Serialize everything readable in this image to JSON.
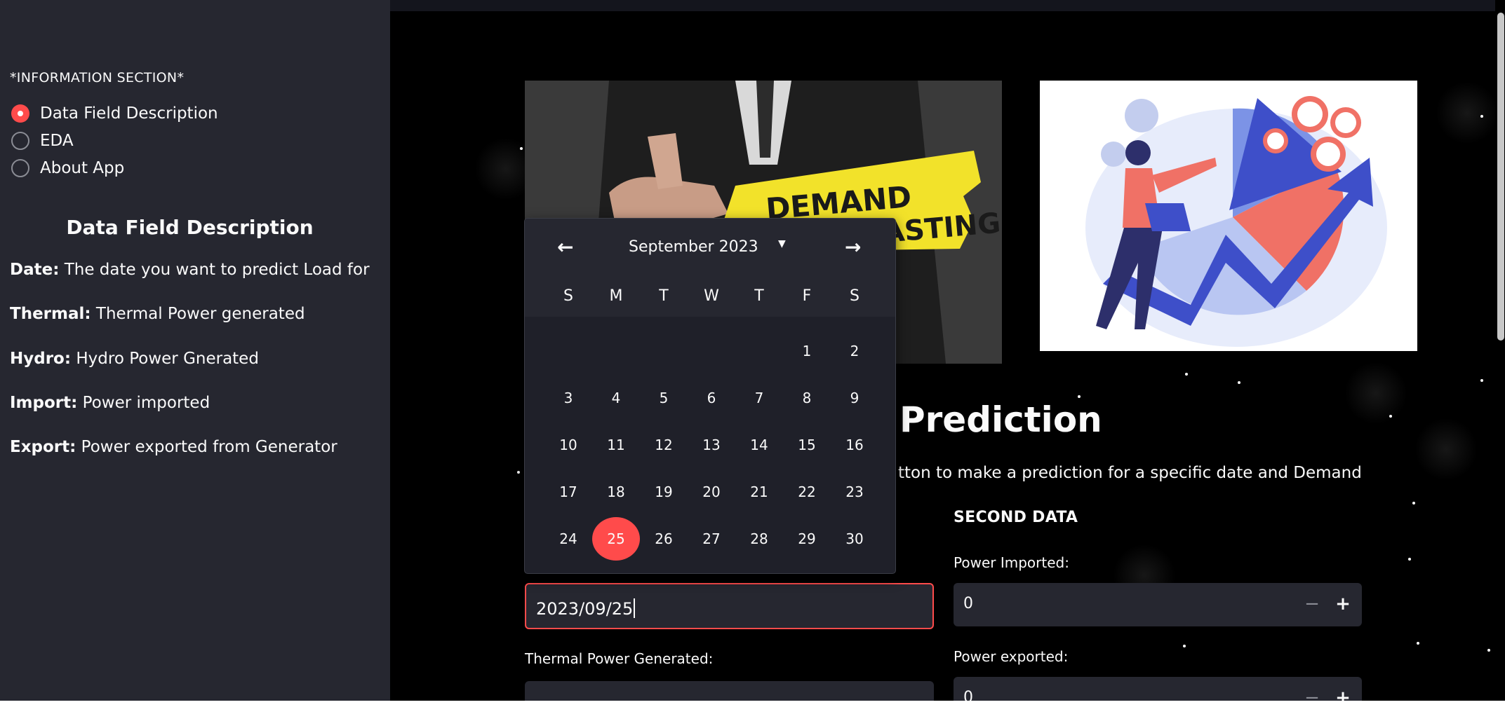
{
  "sidebar": {
    "section_title": "*INFORMATION SECTION*",
    "options": [
      {
        "label": "Data Field Description",
        "selected": true
      },
      {
        "label": "EDA",
        "selected": false
      },
      {
        "label": "About App",
        "selected": false
      }
    ],
    "heading": "Data Field Description",
    "fields": [
      {
        "name": "Date:",
        "desc": "The date you want to predict Load for"
      },
      {
        "name": "Thermal:",
        "desc": "Thermal Power generated"
      },
      {
        "name": "Hydro:",
        "desc": "Hydro Power Gnerated"
      },
      {
        "name": "Import:",
        "desc": "Power imported"
      },
      {
        "name": "Export:",
        "desc": "Power exported from Generator"
      }
    ]
  },
  "images": {
    "left_text_1": "DEMAND",
    "left_text_2": "ECASTING"
  },
  "main": {
    "title": "Prediction",
    "subtitle": "tton to make a prediction for a specific date and Demand",
    "second_data_label": "SECOND DATA",
    "power_imported_label": "Power Imported:",
    "power_imported_value": "0",
    "power_exported_label": "Power exported:",
    "power_exported_value": "0",
    "thermal_label": "Thermal Power Generated:",
    "date_value": "2023/09/25",
    "minus": "−",
    "plus": "+"
  },
  "calendar": {
    "month_label": "September 2023",
    "prev": "←",
    "next": "→",
    "chevron": "▼",
    "weekdays": [
      "S",
      "M",
      "T",
      "W",
      "T",
      "F",
      "S"
    ],
    "days": [
      "1",
      "2",
      "3",
      "4",
      "5",
      "6",
      "7",
      "8",
      "9",
      "10",
      "11",
      "12",
      "13",
      "14",
      "15",
      "16",
      "17",
      "18",
      "19",
      "20",
      "21",
      "22",
      "23",
      "24",
      "25",
      "26",
      "27",
      "28",
      "29",
      "30"
    ],
    "selected_day": "25"
  },
  "colors": {
    "accent": "#ff4b4b",
    "sidebar_bg": "#262730",
    "main_bg": "#000000",
    "text": "#fafafa"
  }
}
